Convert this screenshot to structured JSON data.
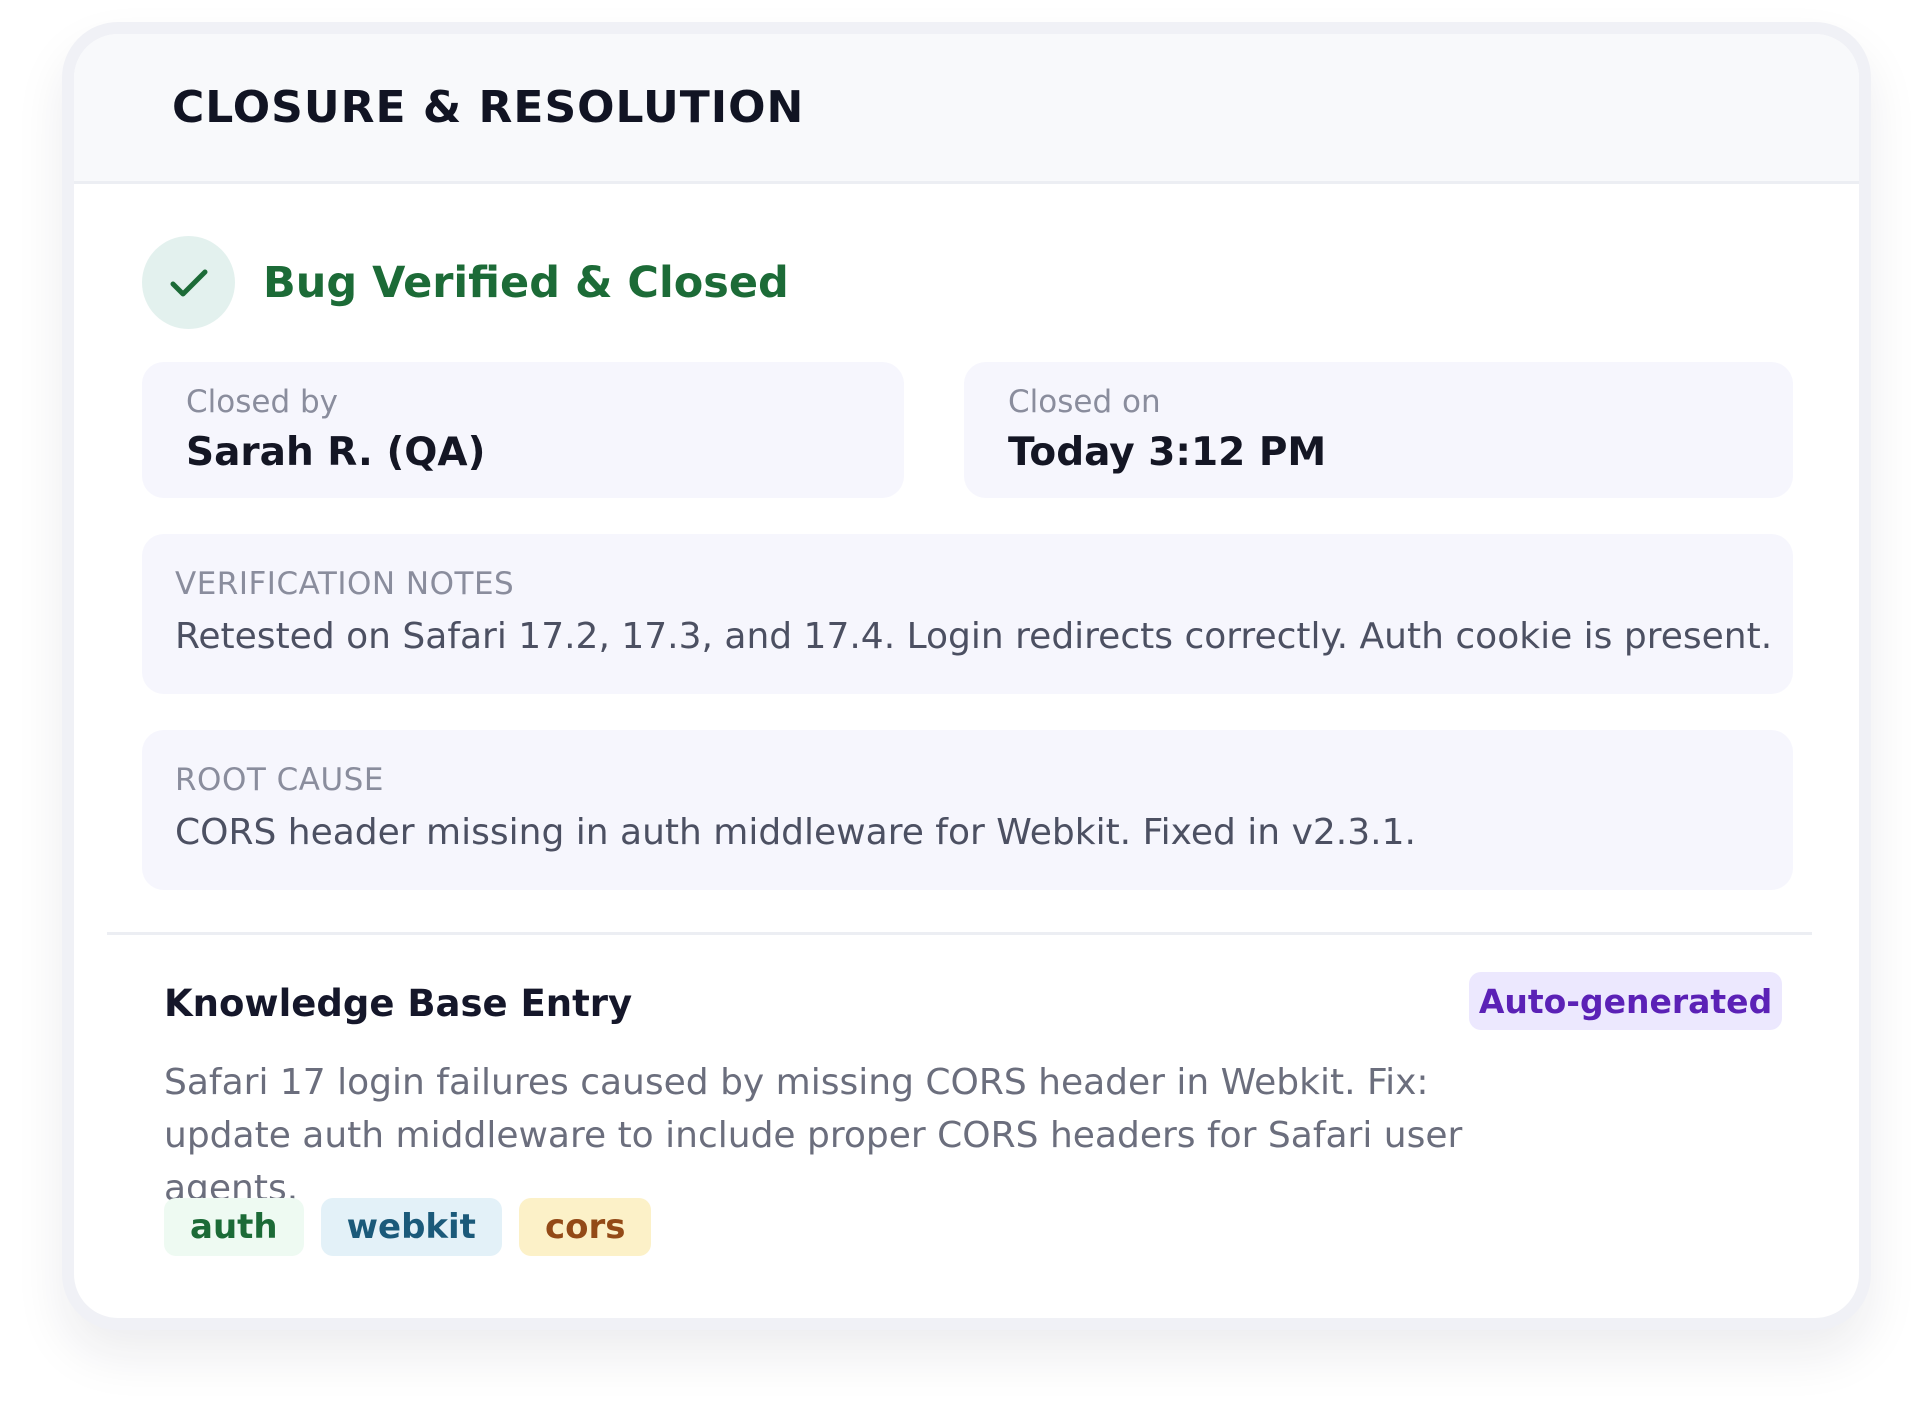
{
  "header": {
    "title": "CLOSURE & RESOLUTION"
  },
  "status": {
    "title": "Bug Verified & Closed",
    "icon": "check-icon",
    "color": "#1c6b37"
  },
  "closed_by": {
    "label": "Closed by",
    "value": "Sarah R. (QA)"
  },
  "closed_on": {
    "label": "Closed on",
    "value": "Today 3:12 PM"
  },
  "verification": {
    "label": "VERIFICATION NOTES",
    "text": "Retested on Safari 17.2, 17.3, and 17.4. Login redirects correctly. Auth cookie is present."
  },
  "root_cause": {
    "label": "ROOT CAUSE",
    "text": "CORS header missing in auth middleware for Webkit. Fixed in v2.3.1."
  },
  "knowledge_base": {
    "title": "Knowledge Base Entry",
    "badge": "Auto-generated",
    "description": "Safari 17 login failures caused by missing CORS header in Webkit. Fix: update auth middleware to include proper CORS headers for Safari user agents.",
    "tags": [
      {
        "label": "auth",
        "bg": "#eefaf2",
        "color": "#1c6b37"
      },
      {
        "label": "webkit",
        "bg": "#e3f1f8",
        "color": "#1b5a7a"
      },
      {
        "label": "cors",
        "bg": "#fcf1c8",
        "color": "#934a17"
      }
    ]
  }
}
